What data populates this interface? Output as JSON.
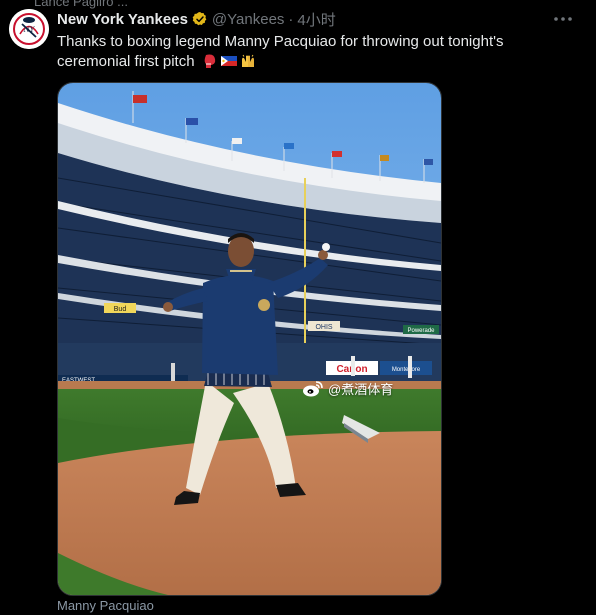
{
  "top_partial": "Lance Pagiiro ...",
  "tweet": {
    "author_name": "New York Yankees",
    "handle": "@Yankees",
    "separator": "·",
    "time": "4小时",
    "text": "Thanks to boxing legend Manny Pacquiao for throwing out tonight's ceremonial first pitch",
    "emojis": [
      "boxing-glove-icon",
      "philippines-flag-icon",
      "raising-hands-icon"
    ]
  },
  "media": {
    "watermark": "@煮酒体育",
    "caption": "Manny Pacquiao",
    "scene_signs": {
      "canon": "Canon",
      "ohis": "OHIS",
      "bud": "Bud",
      "powerade": "Powerade",
      "montefiore": "Montefiore",
      "eastwest": "EASTWEST"
    }
  },
  "colors": {
    "background": "#000000",
    "text_primary": "#e7e9ea",
    "text_secondary": "#71767b",
    "verified_gold": "#e2b719"
  }
}
